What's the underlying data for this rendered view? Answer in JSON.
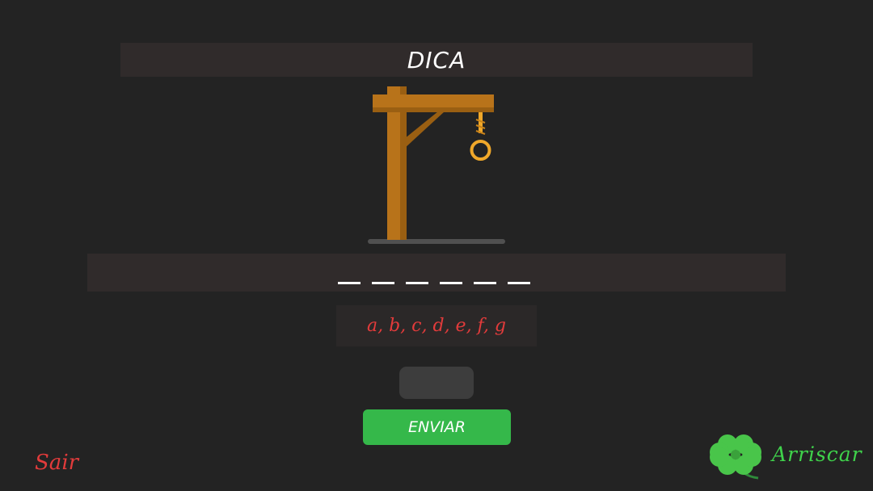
{
  "hint": {
    "label": "DICA"
  },
  "word": {
    "letter_count": 6
  },
  "guessed_letters": "a, b, c, d, e, f, g",
  "guess_input": {
    "value": "",
    "placeholder": ""
  },
  "send_button": {
    "label": "ENVIAR"
  },
  "exit_button": {
    "label": "Sair"
  },
  "risk_button": {
    "label": "Arriscar",
    "icon": "four-leaf-clover-icon"
  },
  "colors": {
    "background": "#232323",
    "panel": "#302b2b",
    "accent_red": "#e23b3b",
    "accent_green": "#35b84a",
    "gallows_wood": "#b8731a",
    "rope": "#f0a82a"
  }
}
